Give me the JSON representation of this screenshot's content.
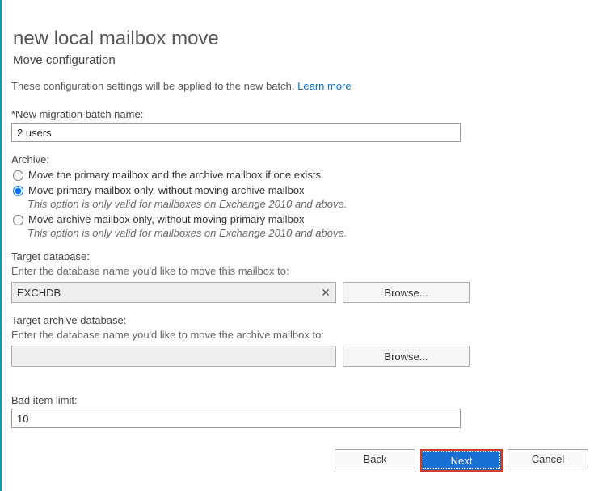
{
  "header": {
    "title": "new local mailbox move",
    "subtitle": "Move configuration"
  },
  "description": {
    "text": "These configuration settings will be applied to the new batch.",
    "learn_more": "Learn more"
  },
  "batch_name": {
    "label": "*New migration batch name:",
    "value": "2 users"
  },
  "archive": {
    "label": "Archive:",
    "opt1": {
      "label": "Move the primary mailbox and the archive mailbox if one exists"
    },
    "opt2": {
      "label": "Move primary mailbox only, without moving archive mailbox",
      "hint": "This option is only valid for mailboxes on Exchange 2010 and above."
    },
    "opt3": {
      "label": "Move archive mailbox only, without moving primary mailbox",
      "hint": "This option is only valid for mailboxes on Exchange 2010 and above."
    }
  },
  "target_db": {
    "label": "Target database:",
    "help": "Enter the database name you'd like to move this mailbox to:",
    "value": "EXCHDB",
    "browse": "Browse..."
  },
  "target_archive_db": {
    "label": "Target archive database:",
    "help": "Enter the database name you'd like to move the archive mailbox to:",
    "value": "",
    "browse": "Browse..."
  },
  "bad_item": {
    "label": "Bad item limit:",
    "value": "10"
  },
  "footer": {
    "back": "Back",
    "next": "Next",
    "cancel": "Cancel"
  }
}
